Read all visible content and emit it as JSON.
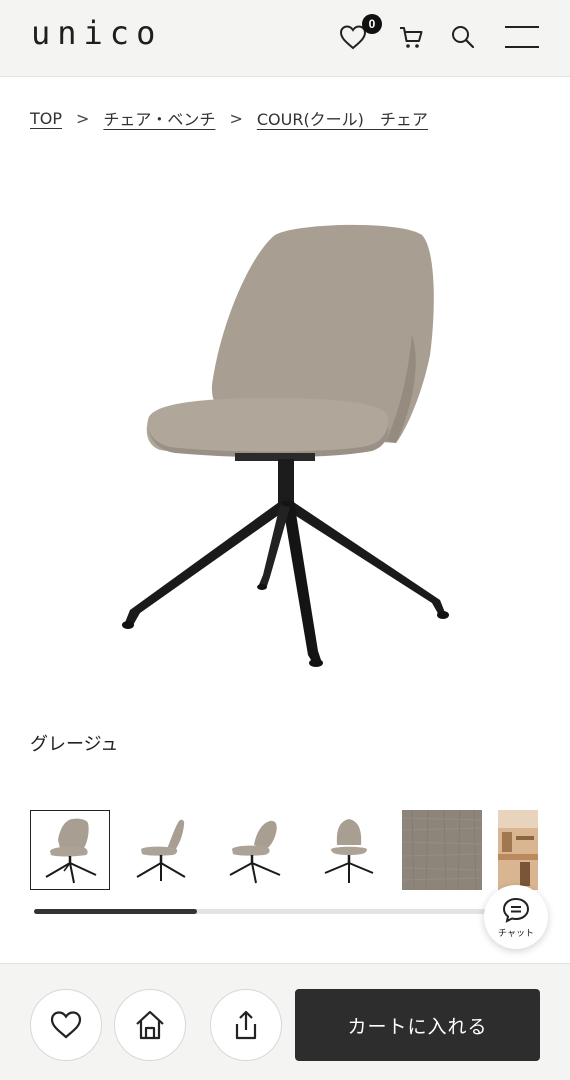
{
  "header": {
    "logo": "unico",
    "favorites_count": "0",
    "icons": [
      "heart-icon",
      "cart-icon",
      "search-icon",
      "menu-icon"
    ]
  },
  "breadcrumb": {
    "items": [
      "TOP",
      "チェア・ベンチ",
      "COUR(クール)　チェア"
    ],
    "separator": ">"
  },
  "product": {
    "color_name": "グレージュ",
    "thumbnail_count": 6,
    "selected_thumbnail": 0
  },
  "chat": {
    "label": "チャット"
  },
  "bottom": {
    "add_to_cart_label": "カートに入れる",
    "icons": [
      "heart-icon",
      "home-icon",
      "share-icon"
    ]
  },
  "colors": {
    "header_bg": "#f4f4f3",
    "cart_button_bg": "#2d2d2d",
    "fabric": "#a79c90"
  }
}
